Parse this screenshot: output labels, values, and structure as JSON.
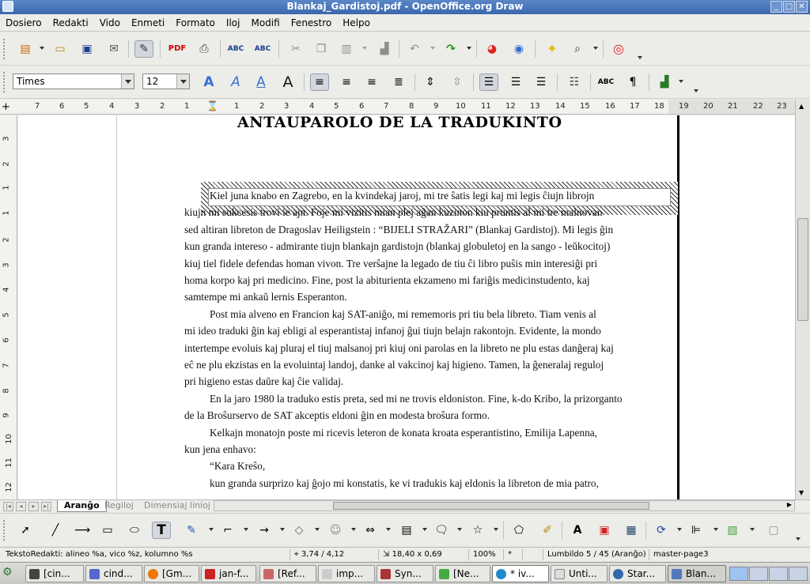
{
  "window": {
    "title": "Blankaj_Gardistoj.pdf - OpenOffice.org Draw"
  },
  "menu": [
    "Dosiero",
    "Redakti",
    "Vido",
    "Enmeti",
    "Formato",
    "Iloj",
    "Modifi",
    "Fenestro",
    "Helpo"
  ],
  "font": {
    "name": "Times",
    "size": "12"
  },
  "hruler": [
    "7",
    "6",
    "5",
    "4",
    "3",
    "2",
    "1",
    "1",
    "2",
    "3",
    "4",
    "5",
    "6",
    "7",
    "8",
    "9",
    "10",
    "11",
    "12",
    "13",
    "14",
    "15",
    "16",
    "17",
    "18",
    "19",
    "20",
    "21",
    "22",
    "23"
  ],
  "vruler": [
    "3",
    "2",
    "1",
    "1",
    "2",
    "3",
    "4",
    "5",
    "6",
    "7",
    "8",
    "9",
    "10",
    "11",
    "12"
  ],
  "document": {
    "heading": "ANTAŬPAROLO DE LA TRADUKINTO",
    "lines": [
      "Kiel juna knabo en Zagrebo, en la kvindekaj jaroj, mi tre ŝatis legi kaj mi legis ĉiujn librojn",
      "kiujn mi sukcesis trovi ie ajn. Foje mi vizitis mian plej aĝan kuzinon kiu pruntis al mi tre malnovan",
      "sed altiran libreton de Dragoslav Heiligstein : “BIJELI STRAŽARI” (Blankaj Gardistoj). Mi legis ĝin",
      "kun granda intereso - admirante tiujn blankajn gardistojn (blankaj globuletoj en la sango - leŭkocitoj)",
      "kiuj tiel fidele defendas homan vivon. Tre verŝajne la legado de tiu ĉi libro puŝis min interesiĝi pri",
      "homa korpo kaj pri medicino. Fine, post la abiturienta ekzameno mi fariĝis medicinstudento, kaj",
      "samtempe mi ankaŭ lernis Esperanton.",
      "Post mia alveno en Francion kaj SAT-aniĝo, mi rememoris pri tiu bela libreto. Tiam venis al",
      "mi ideo traduki ĝin kaj ebligi al esperantistaj infanoj ĝui tiujn belajn rakontojn. Evidente, la mondo",
      "intertempe evoluis kaj pluraj el tiuj malsanoj pri kiuj oni parolas en la libreto ne plu estas danĝeraj kaj",
      "eĉ ne plu ekzistas en la evoluintaj landoj, danke al vakcinoj kaj higieno. Tamen, la ĝeneralaj reguloj",
      "pri higieno estas daŭre kaj ĉie validaj.",
      "En la jaro 1980 la traduko estis preta, sed mi ne trovis eldoniston. Fine, k-do Kribo, la prizorganto",
      "de la Broŝurservo de SAT akceptis eldoni ĝin en modesta broŝura formo.",
      "Kelkajn monatojn poste mi ricevis leteron de konata kroata esperantistino, Emilija Lapenna,",
      "kun jena enhavo:",
      "“Kara Kreŝo,",
      "kun granda surprizo kaj ĝojo mi konstatis, ke vi tradukis kaj eldonis la libreton de mia patro,"
    ]
  },
  "layer_tabs": [
    "Aranĝo",
    "Regiloj",
    "Dimensiaj linioj"
  ],
  "status": {
    "mode": "TekstoRedakti: alineo %a, vico %z, kolumno %s",
    "position": "3,74 / 4,12",
    "size": "18,40 x 0,69",
    "zoom": "100%",
    "modified": "*",
    "page": "Lumbildo 5 / 45 (Aranĝo)",
    "master": "master-page3"
  },
  "taskbar": [
    "[cin...",
    "cind...",
    "[Gm...",
    "jan-f...",
    "[Ref...",
    "imp...",
    "Syn...",
    "[Ne...",
    "* iv...",
    "Unti...",
    "Star...",
    "Blan..."
  ]
}
